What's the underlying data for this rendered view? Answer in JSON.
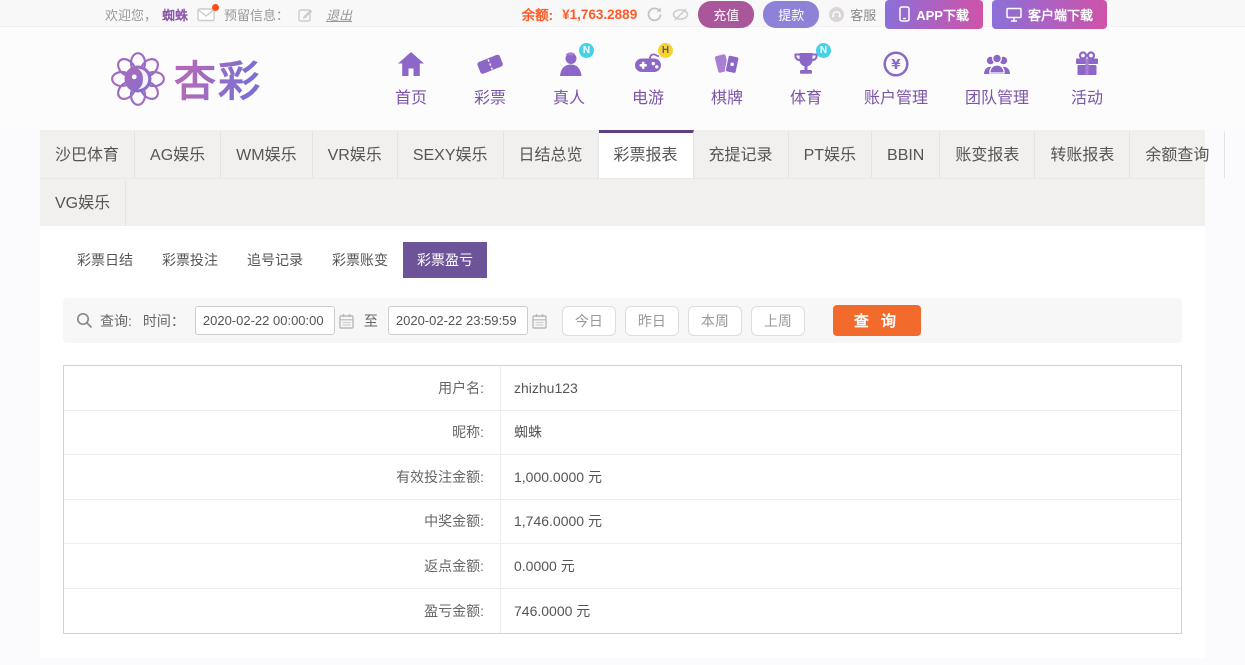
{
  "topbar": {
    "welcome_prefix": "欢迎您，",
    "username": "蜘蛛",
    "reserved_label": "预留信息：",
    "logout": "退出",
    "balance_label": "余额:",
    "balance_value": "¥1,763.2889",
    "recharge": "充值",
    "withdraw": "提款",
    "service": "客服",
    "app_download": "APP下载",
    "client_download": "客户端下载"
  },
  "header": {
    "logo_text": "杏彩",
    "nav": [
      {
        "label": "首页",
        "icon": "home-icon",
        "badge": ""
      },
      {
        "label": "彩票",
        "icon": "ticket-icon",
        "badge": ""
      },
      {
        "label": "真人",
        "icon": "live-person-icon",
        "badge": "N"
      },
      {
        "label": "电游",
        "icon": "gamepad-icon",
        "badge": "H"
      },
      {
        "label": "棋牌",
        "icon": "cards-icon",
        "badge": ""
      },
      {
        "label": "体育",
        "icon": "trophy-icon",
        "badge": "N"
      },
      {
        "label": "账户管理",
        "icon": "coin-icon",
        "badge": ""
      },
      {
        "label": "团队管理",
        "icon": "team-icon",
        "badge": ""
      },
      {
        "label": "活动",
        "icon": "gift-icon",
        "badge": ""
      }
    ]
  },
  "tabs": {
    "row1": [
      "沙巴体育",
      "AG娱乐",
      "WM娱乐",
      "VR娱乐",
      "SEXY娱乐",
      "日结总览",
      "彩票报表",
      "充提记录",
      "PT娱乐",
      "BBIN",
      "账变报表",
      "转账报表",
      "余额查询"
    ],
    "row2": [
      "VG娱乐"
    ],
    "active": "彩票报表"
  },
  "subtabs": {
    "items": [
      "彩票日结",
      "彩票投注",
      "追号记录",
      "彩票账变",
      "彩票盈亏"
    ],
    "active": "彩票盈亏"
  },
  "query": {
    "label": "查询:",
    "time_label": "时间：",
    "start_time": "2020-02-22 00:00:00",
    "to_label": "至",
    "end_time": "2020-02-22 23:59:59",
    "quick_buttons": [
      "今日",
      "昨日",
      "本周",
      "上周"
    ],
    "submit": "查 询"
  },
  "report": {
    "rows": [
      {
        "label": "用户名:",
        "value": "zhizhu123"
      },
      {
        "label": "昵称:",
        "value": "蜘蛛"
      },
      {
        "label": "有效投注金额:",
        "value": "1,000.0000 元"
      },
      {
        "label": "中奖金额:",
        "value": "1,746.0000 元"
      },
      {
        "label": "返点金额:",
        "value": "0.0000 元"
      },
      {
        "label": "盈亏金额:",
        "value": "746.0000 元"
      }
    ]
  },
  "colors": {
    "accent_purple": "#6d5499",
    "tab_active_border": "#5e4185",
    "nav_purple": "#8c67c8",
    "balance_orange": "#ff5a26",
    "recharge_pink": "#a9569b",
    "withdraw_violet": "#8d82d8",
    "submit_orange": "#f26a2c",
    "badge_cyan": "#45d1e8",
    "badge_yellow": "#f6d32d"
  }
}
